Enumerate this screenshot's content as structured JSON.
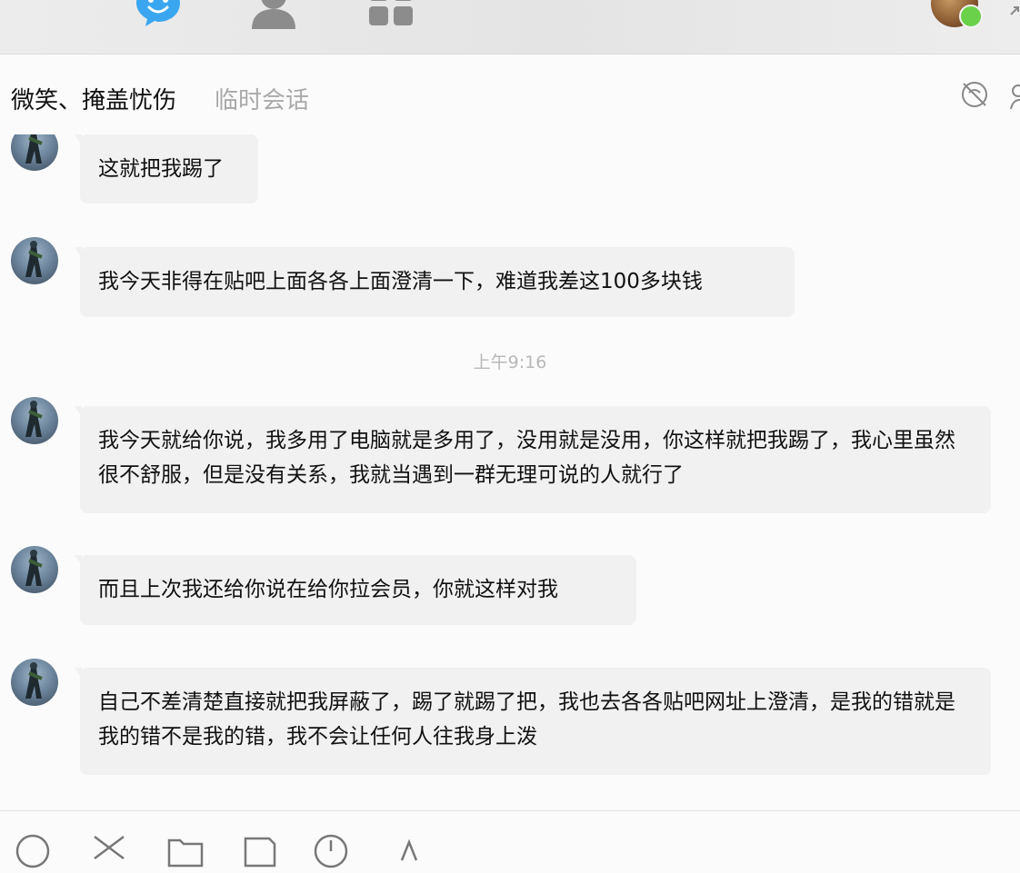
{
  "nav": {
    "icons": [
      "chat-bubble-icon",
      "contacts-icon",
      "apps-grid-icon"
    ],
    "accent_color": "#3aa6f0"
  },
  "chat": {
    "name": "微笑、掩盖忧伤",
    "tag": "临时会话"
  },
  "messages": [
    {
      "text": "这就把我踢了"
    },
    {
      "text": "我今天非得在贴吧上面各各上面澄清一下，难道我差这100多块钱"
    },
    {
      "timestamp": "上午9:16"
    },
    {
      "text": "我今天就给你说，我多用了电脑就是多用了，没用就是没用，你这样就把我踢了，我心里虽然很不舒服，但是没有关系，我就当遇到一群无理可说的人就行了"
    },
    {
      "text": "而且上次我还给你说在给你拉会员，你就这样对我"
    },
    {
      "text": "自己不差清楚直接就把我屏蔽了，踢了就踢了把，我也去各各贴吧网址上澄清，是我的错就是我的错不是我的错，我不会让任何人往我身上泼"
    }
  ],
  "toolbar": {
    "icons": [
      "emoji-icon",
      "scissors-icon",
      "folder-icon",
      "image-icon",
      "history-icon",
      "more-icon"
    ]
  },
  "status": {
    "online_color": "#6ad14b"
  }
}
